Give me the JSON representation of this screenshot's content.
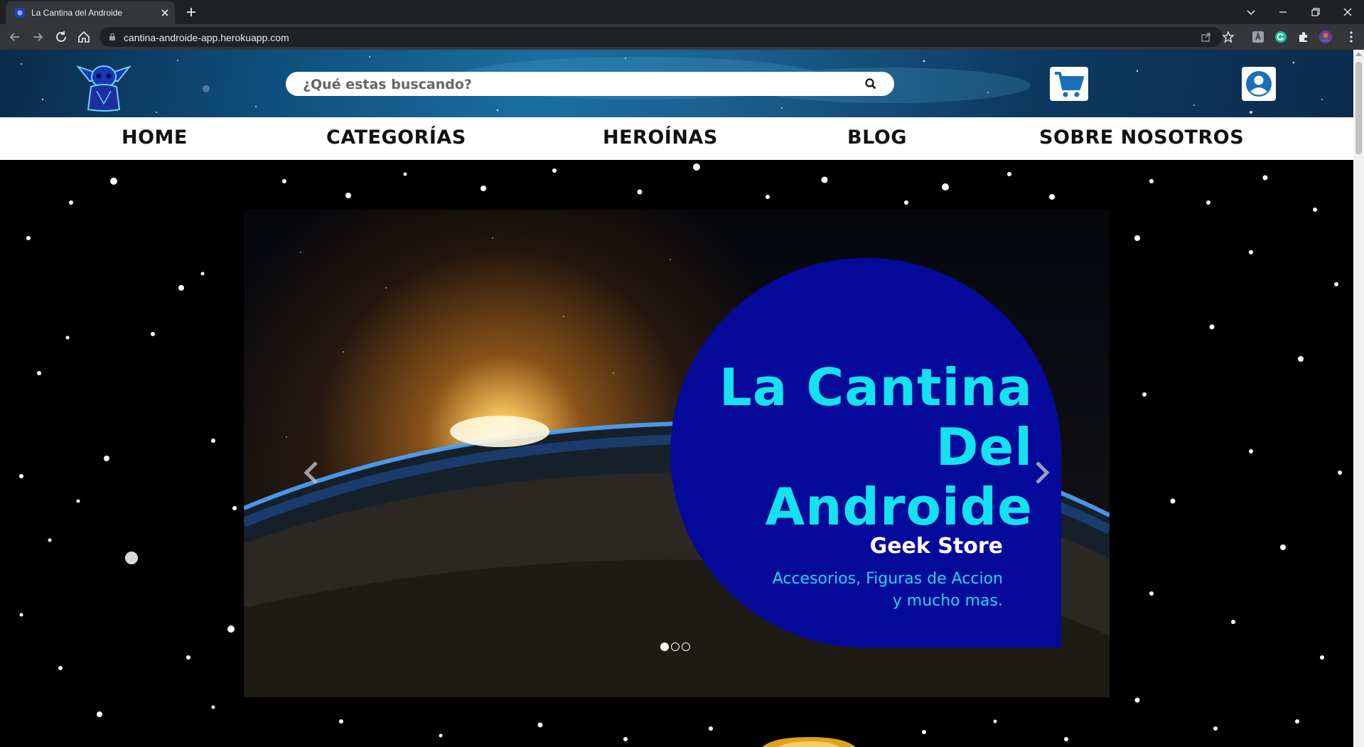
{
  "browser": {
    "tab_title": "La Cantina del Androide",
    "url": "cantina-androide-app.herokuapp.com"
  },
  "header": {
    "search_placeholder": "¿Qué estas buscando?",
    "icons": [
      "logo-grogu-icon",
      "search-icon",
      "cart-icon",
      "user-icon"
    ]
  },
  "nav": {
    "items": [
      {
        "label": "HOME"
      },
      {
        "label": "CATEGORÍAS"
      },
      {
        "label": "HEROÍNAS"
      },
      {
        "label": "BLOG"
      },
      {
        "label": "SOBRE NOSOTROS"
      }
    ]
  },
  "hero": {
    "brand_line1": "La Cantina",
    "brand_line2": "Del Androide",
    "subtitle": "Geek Store",
    "desc_line1": "Accesorios, Figuras de Accion",
    "desc_line2": "y mucho mas.",
    "slide_count": 3,
    "active_slide": 1
  },
  "colors": {
    "header_bg": "#1a5e8e",
    "nav_bg": "#ffffff",
    "brand_bubble": "#050a9a",
    "brand_cyan": "#14e2f0",
    "cart_icon": "#1b6fb8",
    "user_icon": "#1b6fb8"
  }
}
